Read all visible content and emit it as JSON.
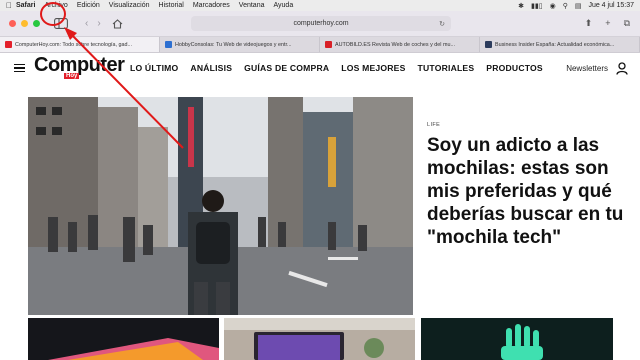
{
  "menubar": {
    "app": "Safari",
    "items": [
      "Archivo",
      "Edición",
      "Visualización",
      "Historial",
      "Marcadores",
      "Ventana",
      "Ayuda"
    ],
    "datetime": "Jue 4 jul  15:37"
  },
  "browser": {
    "url": "computerhoy.com",
    "tabs": [
      {
        "label": "ComputerHoy.com: Todo sobre tecnología, gad...",
        "favicon_color": "#e3202b",
        "active": true
      },
      {
        "label": "HobbyConsolas: Tu Web de videojuegos y entr...",
        "favicon_color": "#2d6fd1",
        "active": false
      },
      {
        "label": "AUTOBILD.ES Revista Web de coches y del mu...",
        "favicon_color": "#d81f26",
        "active": false
      },
      {
        "label": "Business Insider España: Actualidad económica...",
        "favicon_color": "#2b3b5c",
        "active": false
      }
    ]
  },
  "site": {
    "logo_word": "Computer",
    "logo_badge": "Hoy",
    "nav": [
      "LO ÚLTIMO",
      "ANÁLISIS",
      "GUÍAS DE COMPRA",
      "LOS MEJORES",
      "TUTORIALES",
      "PRODUCTOS"
    ],
    "newsletters": "Newsletters"
  },
  "hero": {
    "tag": "LIFE",
    "title": "Soy un adicto a las mochilas: estas son mis preferidas y qué deberías buscar en tu \"mochila tech\""
  },
  "colors": {
    "accent_red": "#e01919",
    "brand_red": "#e3202b"
  }
}
